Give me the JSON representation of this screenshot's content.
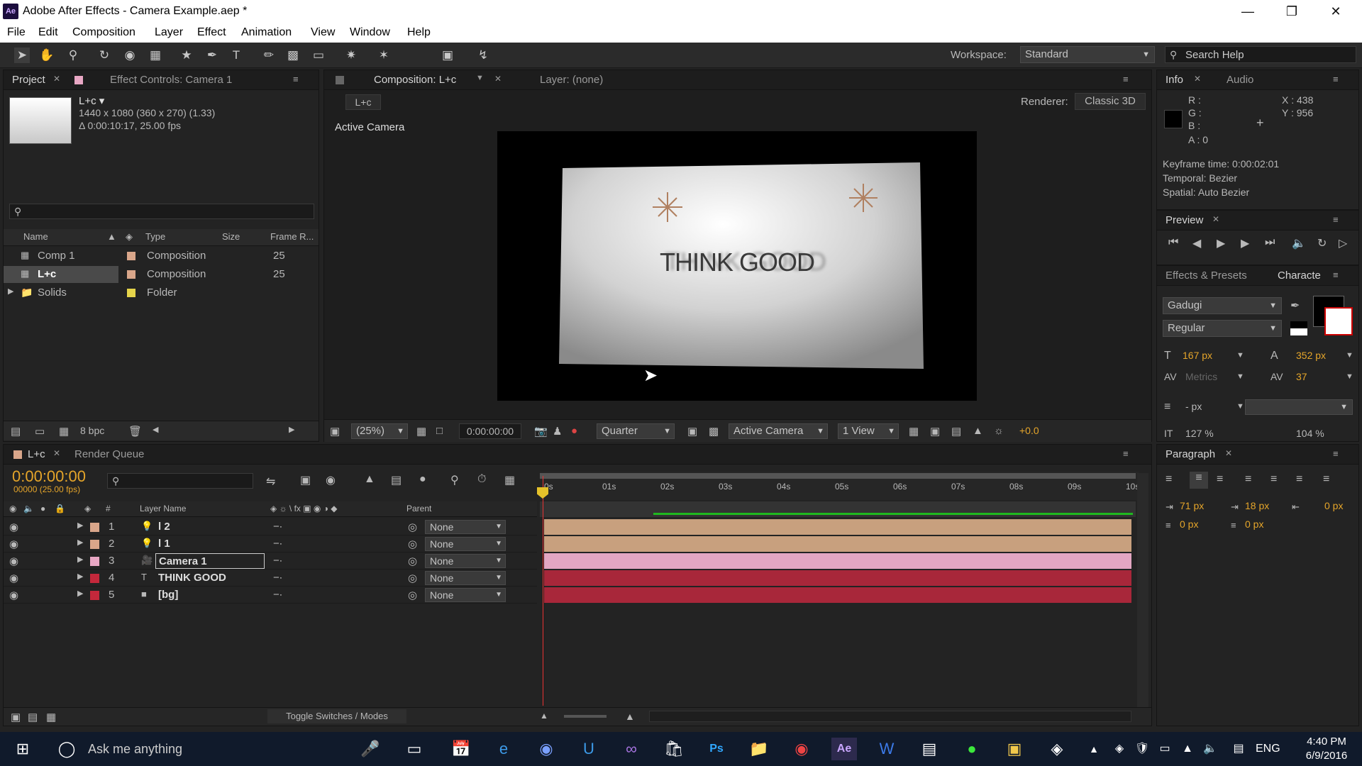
{
  "window": {
    "title": "Adobe After Effects - Camera Example.aep *",
    "app_badge": "Ae"
  },
  "menu": [
    "File",
    "Edit",
    "Composition",
    "Layer",
    "Effect",
    "Animation",
    "View",
    "Window",
    "Help"
  ],
  "toolbar": {
    "workspace_label": "Workspace:",
    "workspace_value": "Standard",
    "search_placeholder": "Search Help"
  },
  "project": {
    "tab_project": "Project",
    "tab_effect": "Effect Controls: Camera 1",
    "comp_name": "L+c ▾",
    "comp_size": "1440 x 1080  (360 x 270) (1.33)",
    "comp_duration": "Δ 0:00:10:17, 25.00 fps",
    "columns": {
      "name": "Name",
      "type": "Type",
      "size": "Size",
      "frame_rate": "Frame R..."
    },
    "items": [
      {
        "name": "Comp 1",
        "type": "Composition",
        "frame": "25",
        "color": "#d9a68a"
      },
      {
        "name": "L+c",
        "type": "Composition",
        "frame": "25",
        "color": "#d9a68a"
      },
      {
        "name": "Solids",
        "type": "Folder",
        "frame": "",
        "color": "#e5d44a"
      }
    ],
    "bpc": "8 bpc"
  },
  "composition": {
    "tab": "Composition: L+c",
    "layer_tab": "Layer: (none)",
    "crumb": "L+c",
    "renderer_label": "Renderer:",
    "renderer_value": "Classic 3D",
    "view_label": "Active Camera",
    "card_text": "THINK GOOD",
    "zoom": "(25%)",
    "timecode": "0:00:00:00",
    "resolution": "Quarter",
    "camera": "Active Camera",
    "views": "1 View",
    "exposure": "+0.0"
  },
  "info": {
    "tab_info": "Info",
    "tab_audio": "Audio",
    "r": "R :",
    "g": "G :",
    "b": "B :",
    "a": "A : 0",
    "x": "X : 438",
    "y": "Y : 956",
    "keyframe": "Keyframe time: 0:00:02:01",
    "temporal": "Temporal: Bezier",
    "spatial": "Spatial: Auto Bezier"
  },
  "preview": {
    "tab": "Preview"
  },
  "character": {
    "tab_effects": "Effects & Presets",
    "tab_char": "Characte",
    "font": "Gadugi",
    "style": "Regular",
    "size": "167 px",
    "leading": "352 px",
    "kerning": "Metrics",
    "tracking": "37",
    "stroke": "- px",
    "scale_v": "127 %",
    "scale_h": "104 %"
  },
  "paragraph": {
    "tab": "Paragraph",
    "indent_left": "71 px",
    "indent_first": "18 px",
    "indent_right": "0 px",
    "space_before": "0 px",
    "space_after": "0 px"
  },
  "timeline": {
    "tab_comp": "L+c",
    "tab_render": "Render Queue",
    "timecode": "0:00:00:00",
    "fps": "00000 (25.00 fps)",
    "col_layer": "Layer Name",
    "col_parent": "Parent",
    "ruler": [
      "0s",
      "01s",
      "02s",
      "03s",
      "04s",
      "05s",
      "06s",
      "07s",
      "08s",
      "09s",
      "10s"
    ],
    "layers": [
      {
        "num": "1",
        "name": "l 2",
        "parent": "None",
        "color": "#d9a68a",
        "bar": "#c8a07e",
        "icon": "light-icon"
      },
      {
        "num": "2",
        "name": "l 1",
        "parent": "None",
        "color": "#d9a68a",
        "bar": "#c8a07e",
        "icon": "light-icon"
      },
      {
        "num": "3",
        "name": "Camera 1",
        "parent": "None",
        "color": "#e8a7c4",
        "bar": "#e3a6c2",
        "icon": "camera-icon"
      },
      {
        "num": "4",
        "name": "THINK GOOD",
        "parent": "None",
        "color": "#c4283b",
        "bar": "#a8273a",
        "icon": "text-icon"
      },
      {
        "num": "5",
        "name": "[bg]",
        "parent": "None",
        "color": "#c4283b",
        "bar": "#a8273a",
        "icon": "solid-icon"
      }
    ],
    "toggle_label": "Toggle Switches / Modes"
  },
  "taskbar": {
    "search": "Ask me anything",
    "lang": "ENG",
    "time": "4:40 PM",
    "date": "6/9/2016"
  }
}
